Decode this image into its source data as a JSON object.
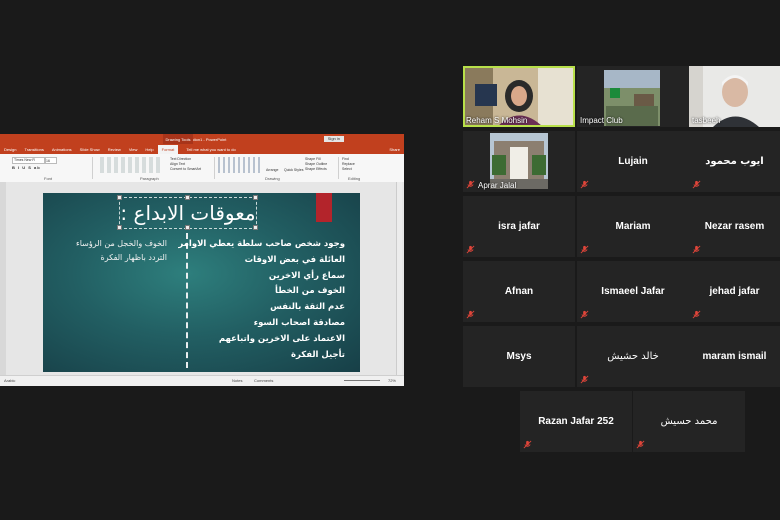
{
  "powerpoint": {
    "doc_title": "Presentation1 - PowerPoint",
    "drawing_tools_label": "Drawing Tools",
    "sign_in_label": "Sign in",
    "tabs": [
      "Design",
      "Transitions",
      "Animations",
      "Slide Show",
      "Review",
      "View",
      "Help",
      "Format"
    ],
    "active_tab": "Format",
    "tell_me": "Tell me what you want to do",
    "share_label": "Share",
    "ribbon": {
      "font_name": "Times New R",
      "font_size": "16",
      "format_buttons": "B I U S ab",
      "text_direction": "Text Direction",
      "align_text": "Align Text",
      "convert_smartart": "Convert to SmartArt",
      "arrange_label": "Arrange",
      "quick_styles_label": "Quick Styles",
      "shape_fill": "Shape Fill",
      "shape_outline": "Shape Outline",
      "shape_effects": "Shape Effects",
      "find_label": "Find",
      "replace_label": "Replace",
      "select_label": "Select",
      "group_font": "Font",
      "group_paragraph": "Paragraph",
      "group_drawing": "Drawing",
      "group_editing": "Editing"
    },
    "slide": {
      "title": "معوقات الابداع :",
      "right_items": [
        "وجود شخص صاحب سلطة يعطي الاوامر",
        "العائلة في بعض الاوقات",
        "سماع رأي الاخرين",
        "الخوف من الخطأ",
        "عدم الثقة بالنفس",
        "مصادقة اصحاب السوء",
        "الاعتماد على الاخرين واتباعهم",
        "تأجيل الفكرة"
      ],
      "left_items": [
        "الخوف والخجل من الرؤساء",
        "التردد باظهار الفكرة"
      ]
    },
    "status": {
      "slide_info": "Arabic",
      "notes_label": "Notes",
      "comments_label": "Comments",
      "zoom": "72%"
    }
  },
  "participants": [
    {
      "name": "Reham S Mohsin",
      "kind": "video",
      "active": true
    },
    {
      "name": "Impact Club",
      "kind": "image"
    },
    {
      "name": "tasbeeh",
      "kind": "video"
    },
    {
      "name": "Aprar Jalal",
      "kind": "image"
    },
    {
      "name": "Lujain",
      "kind": "name"
    },
    {
      "name": "ايوب محمود",
      "kind": "name"
    },
    {
      "name": "isra jafar",
      "kind": "name"
    },
    {
      "name": "Mariam",
      "kind": "name"
    },
    {
      "name": "Nezar rasem",
      "kind": "name"
    },
    {
      "name": "Afnan",
      "kind": "name"
    },
    {
      "name": "Ismaeel Jafar",
      "kind": "name"
    },
    {
      "name": "jehad jafar",
      "kind": "name"
    },
    {
      "name": "Msys",
      "kind": "name"
    },
    {
      "name": "خالد حشيش",
      "kind": "name"
    },
    {
      "name": "maram ismail",
      "kind": "name"
    },
    {
      "name": "Razan Jafar 252",
      "kind": "name"
    },
    {
      "name": "محمد حسيش",
      "kind": "name"
    }
  ],
  "colors": {
    "background": "#1a1a1a",
    "tile": "#242424",
    "active_speaker": "#b8e04a",
    "muted_icon": "#e0453a",
    "ppt_accent": "#c1401e"
  },
  "icons": {
    "muted": "microphone-muted-icon"
  }
}
